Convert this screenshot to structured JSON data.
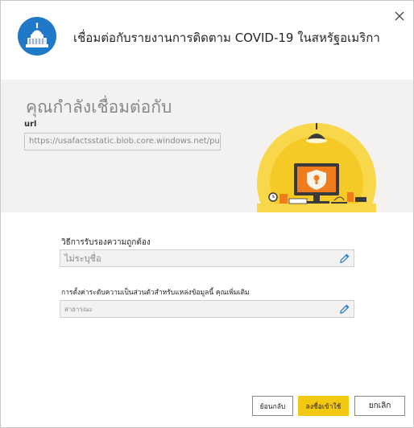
{
  "dialog": {
    "title": "เชื่อมต่อกับรายงานการติดตาม COVID-19 ในสหรัฐอเมริกา",
    "close_icon": "close-icon"
  },
  "connect": {
    "heading": "คุณกำลังเชื่อมต่อกับ",
    "url_label": "url",
    "url_value": "https://usafactsstatic.blob.core.windows.net/publ"
  },
  "auth": {
    "label": "วิธีการรับรองความถูกต้อง",
    "value": "ไม่ระบุชื่อ"
  },
  "privacy": {
    "label": "การตั้งค่าระดับความเป็นส่วนตัวสำหรับแหล่งข้อมูลนี้ คุณเพิ่มเติม",
    "value": "สาธารณะ"
  },
  "buttons": {
    "back": "ย้อนกลับ",
    "next": "ลงชื่อเข้าใช้",
    "cancel": "ยกเลิก"
  },
  "colors": {
    "accent": "#f2c811",
    "band": "#f3f2f1",
    "icon_bg": "#1f78c8"
  }
}
